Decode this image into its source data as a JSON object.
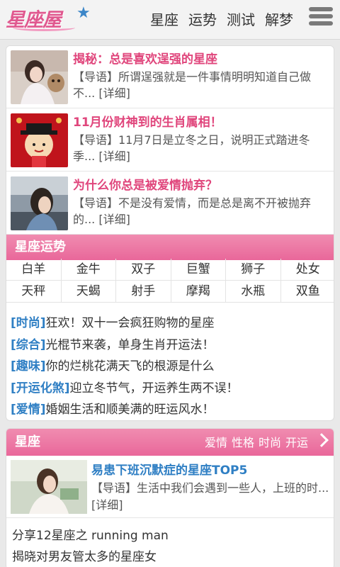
{
  "header": {
    "logo_text": "星座屋",
    "nav": [
      "星座",
      "运势",
      "测试",
      "解梦"
    ]
  },
  "articles": [
    {
      "title": "揭秘：总是喜欢逞强的星座",
      "intro": "【导语】所谓逞强就是一件事情明明知道自己做不...",
      "more": "[详细]"
    },
    {
      "title": "11月份财神到的生肖属相！",
      "intro": "【导语】11月7日是立冬之日，说明正式踏进冬季...",
      "more": "[详细]"
    },
    {
      "title": "为什么你总是被爱情抛弃？",
      "intro": "【导语】不是没有爱情，而是总是离不开被抛弃的...",
      "more": "[详细]"
    }
  ],
  "fortune_section": {
    "title": "星座运势",
    "signs_row1": [
      "白羊",
      "金牛",
      "双子",
      "巨蟹",
      "狮子",
      "处女"
    ],
    "signs_row2": [
      "天秤",
      "天蝎",
      "射手",
      "摩羯",
      "水瓶",
      "双鱼"
    ]
  },
  "news": [
    {
      "tag": "[时尚]",
      "text": "狂欢！双十一会疯狂购物的星座"
    },
    {
      "tag": "[综合]",
      "text": "光棍节来袭，单身生肖开运法！"
    },
    {
      "tag": "[趣味]",
      "text": "你的烂桃花满天飞的根源是什么"
    },
    {
      "tag": "[开运化煞]",
      "text": "迎立冬节气，开运养生两不误！"
    },
    {
      "tag": "[爱情]",
      "text": "婚姻生活和顺美满的旺运风水！"
    }
  ],
  "constellation_section": {
    "title": "星座",
    "links": [
      "爱情",
      "性格",
      "时尚",
      "开运"
    ],
    "feature": {
      "title": "易患下班沉默症的星座TOP5",
      "intro": "【导语】生活中我们会遇到一些人，上班的时...",
      "more": "[详细]"
    },
    "list": [
      "分享12星座之 running man",
      "揭晓对男友管太多的星座女"
    ]
  },
  "colors": {
    "accent_pink": "#e0467c",
    "accent_blue": "#2f7fc4",
    "header_pink": "#ec78a4"
  }
}
